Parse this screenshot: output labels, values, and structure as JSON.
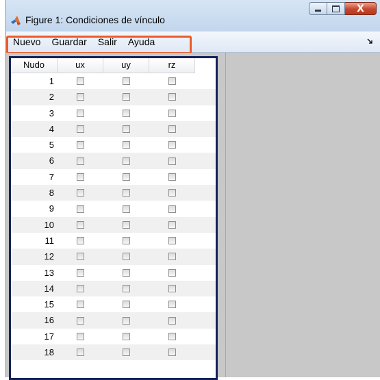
{
  "window": {
    "title": "Figure 1: Condiciones de vínculo",
    "close_glyph": "X"
  },
  "menu": {
    "items": [
      "Nuevo",
      "Guardar",
      "Salir",
      "Ayuda"
    ],
    "overflow_icon": "chevron-overflow-icon"
  },
  "table": {
    "columns": [
      "Nudo",
      "ux",
      "uy",
      "rz"
    ],
    "rows": [
      {
        "nudo": "1",
        "ux": false,
        "uy": false,
        "rz": false
      },
      {
        "nudo": "2",
        "ux": false,
        "uy": false,
        "rz": false
      },
      {
        "nudo": "3",
        "ux": false,
        "uy": false,
        "rz": false
      },
      {
        "nudo": "4",
        "ux": false,
        "uy": false,
        "rz": false
      },
      {
        "nudo": "5",
        "ux": false,
        "uy": false,
        "rz": false
      },
      {
        "nudo": "6",
        "ux": false,
        "uy": false,
        "rz": false
      },
      {
        "nudo": "7",
        "ux": false,
        "uy": false,
        "rz": false
      },
      {
        "nudo": "8",
        "ux": false,
        "uy": false,
        "rz": false
      },
      {
        "nudo": "9",
        "ux": false,
        "uy": false,
        "rz": false
      },
      {
        "nudo": "10",
        "ux": false,
        "uy": false,
        "rz": false
      },
      {
        "nudo": "11",
        "ux": false,
        "uy": false,
        "rz": false
      },
      {
        "nudo": "12",
        "ux": false,
        "uy": false,
        "rz": false
      },
      {
        "nudo": "13",
        "ux": false,
        "uy": false,
        "rz": false
      },
      {
        "nudo": "14",
        "ux": false,
        "uy": false,
        "rz": false
      },
      {
        "nudo": "15",
        "ux": false,
        "uy": false,
        "rz": false
      },
      {
        "nudo": "16",
        "ux": false,
        "uy": false,
        "rz": false
      },
      {
        "nudo": "17",
        "ux": false,
        "uy": false,
        "rz": false
      },
      {
        "nudo": "18",
        "ux": false,
        "uy": false,
        "rz": false
      }
    ]
  },
  "colors": {
    "menu_highlight": "#ea5b2a",
    "table_highlight": "#13225a",
    "figure_background": "#c8c8c8"
  }
}
